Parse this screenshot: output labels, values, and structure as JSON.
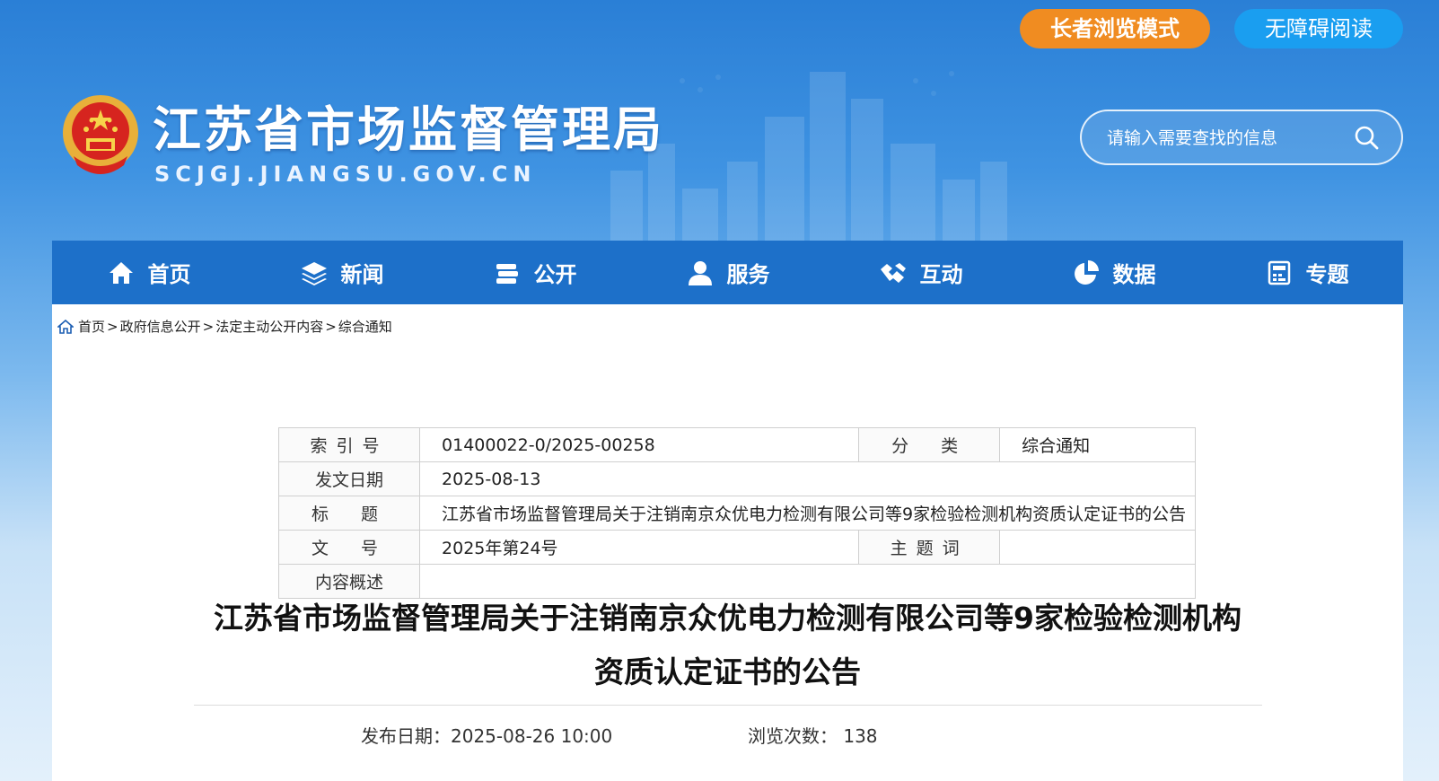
{
  "header": {
    "site_title": "江苏省市场监督管理局",
    "site_domain": "SCJGJ.JIANGSU.GOV.CN",
    "elder_mode_label": "长者浏览模式",
    "accessibility_label": "无障碍阅读",
    "search_placeholder": "请输入需要查找的信息",
    "colors": {
      "elder_button": "#f08c21",
      "accessibility_button": "#1a9ef0",
      "nav_bar": "#1d70c9"
    }
  },
  "nav": {
    "items": [
      {
        "label": "首页",
        "icon": "home-icon"
      },
      {
        "label": "新闻",
        "icon": "layers-icon"
      },
      {
        "label": "公开",
        "icon": "documents-icon"
      },
      {
        "label": "服务",
        "icon": "user-icon"
      },
      {
        "label": "互动",
        "icon": "handshake-icon"
      },
      {
        "label": "数据",
        "icon": "pie-chart-icon"
      },
      {
        "label": "专题",
        "icon": "calculator-icon"
      }
    ]
  },
  "breadcrumb": {
    "items": [
      "首页",
      "政府信息公开",
      "法定主动公开内容",
      "综合通知"
    ],
    "separator": ">"
  },
  "info": {
    "index_label": "索引号",
    "index_value": "01400022-0/2025-00258",
    "category_label": "分类",
    "category_value": "综合通知",
    "issue_date_label": "发文日期",
    "issue_date_value": "2025-08-13",
    "title_label": "标题",
    "title_value": "江苏省市场监督管理局关于注销南京众优电力检测有限公司等9家检验检测机构资质认定证书的公告",
    "doc_number_label": "文号",
    "doc_number_value": "2025年第24号",
    "keywords_label": "主题词",
    "keywords_value": "",
    "summary_label": "内容概述",
    "summary_value": ""
  },
  "article": {
    "title_line1": "江苏省市场监督管理局关于注销南京众优电力检测有限公司等9家检验检测机构",
    "title_line2": "资质认定证书的公告",
    "publish_label": "发布日期：",
    "publish_value": "2025-08-26 10:00",
    "views_label": "浏览次数：",
    "views_value": "138"
  }
}
